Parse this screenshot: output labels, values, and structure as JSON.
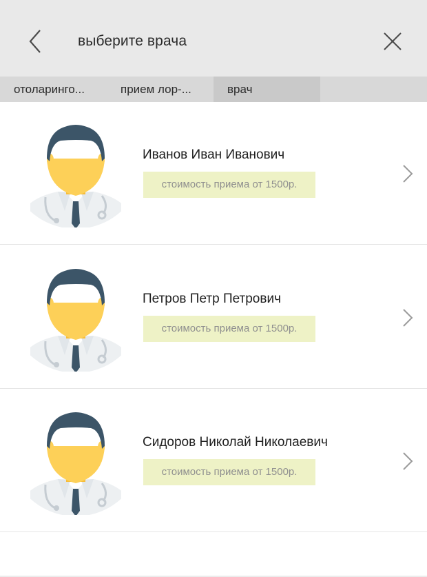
{
  "header": {
    "title": "выберите врача",
    "back_icon": "chevron-left-icon",
    "close_icon": "close-icon"
  },
  "breadcrumbs": [
    {
      "label": "отоларинго..."
    },
    {
      "label": "прием лор-..."
    },
    {
      "label": "врач",
      "active": true
    }
  ],
  "doctors": [
    {
      "name": "Иванов Иван Иванович",
      "price": "стоимость приема от 1500р."
    },
    {
      "name": "Петров Петр Петрович",
      "price": "стоимость приема от 1500р."
    },
    {
      "name": "Сидоров Николай Николаевич",
      "price": "стоимость приема от 1500р."
    }
  ],
  "colors": {
    "header_bg": "#e9e9e9",
    "breadcrumb_bg": "#d8d8d8",
    "breadcrumb_active_bg": "#c9c9c9",
    "price_badge_bg": "#eef2c6",
    "avatar_hair": "#3c5568",
    "avatar_skin": "#fdd058",
    "avatar_coat": "#edf0f2"
  }
}
